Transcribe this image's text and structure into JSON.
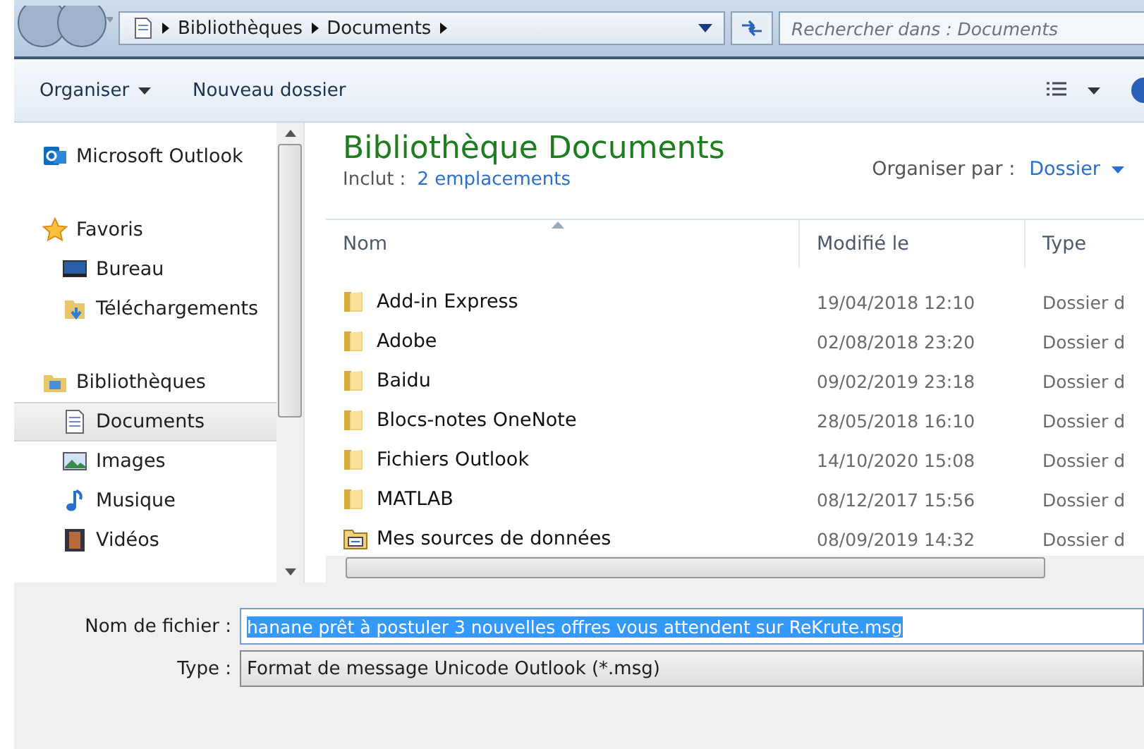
{
  "address_bar": {
    "crumbs": [
      "Bibliothèques",
      "Documents"
    ]
  },
  "search": {
    "placeholder": "Rechercher dans : Documents"
  },
  "toolbar": {
    "buttons": [
      {
        "label": "Organiser",
        "dropdown": true
      },
      {
        "label": "Nouveau dossier",
        "dropdown": false
      }
    ]
  },
  "sidebar": {
    "items": [
      {
        "label": "Microsoft Outlook",
        "selected": false
      },
      {
        "label": "Favoris",
        "selected": false,
        "children": [
          {
            "label": "Bureau",
            "selected": false
          },
          {
            "label": "Téléchargements",
            "selected": false
          }
        ]
      },
      {
        "label": "Bibliothèques",
        "selected": false,
        "children": [
          {
            "label": "Documents",
            "selected": true
          },
          {
            "label": "Images",
            "selected": false
          },
          {
            "label": "Musique",
            "selected": false
          },
          {
            "label": "Vidéos",
            "selected": false
          }
        ]
      }
    ]
  },
  "library": {
    "title": "Bibliothèque Documents",
    "includes_label": "Inclut :",
    "includes_link": "2 emplacements",
    "arrange_label": "Organiser par :",
    "arrange_value": "Dossier"
  },
  "table": {
    "columns": [
      "Nom",
      "Modifié le",
      "Type"
    ],
    "rows": [
      {
        "kind": "folder",
        "name": "Add-in Express",
        "modified": "19/04/2018 12:10",
        "type": "Dossier d"
      },
      {
        "kind": "folder",
        "name": "Adobe",
        "modified": "02/08/2018 23:20",
        "type": "Dossier d"
      },
      {
        "kind": "folder",
        "name": "Baidu",
        "modified": "09/02/2019 23:18",
        "type": "Dossier d"
      },
      {
        "kind": "folder",
        "name": "Blocs-notes OneNote",
        "modified": "28/05/2018 16:10",
        "type": "Dossier d"
      },
      {
        "kind": "folder",
        "name": "Fichiers Outlook",
        "modified": "14/10/2020 15:08",
        "type": "Dossier d"
      },
      {
        "kind": "folder",
        "name": "MATLAB",
        "modified": "08/12/2017 15:56",
        "type": "Dossier d"
      },
      {
        "kind": "datasource",
        "name": "Mes sources de données",
        "modified": "08/09/2019 14:32",
        "type": "Dossier d"
      }
    ]
  },
  "file_name": {
    "label": "Nom de fichier :",
    "value": "hanane prêt à postuler  3 nouvelles offres vous attendent sur ReKrute.msg"
  },
  "file_type": {
    "label": "Type :",
    "value": "Format de message Unicode Outlook (*.msg)"
  }
}
